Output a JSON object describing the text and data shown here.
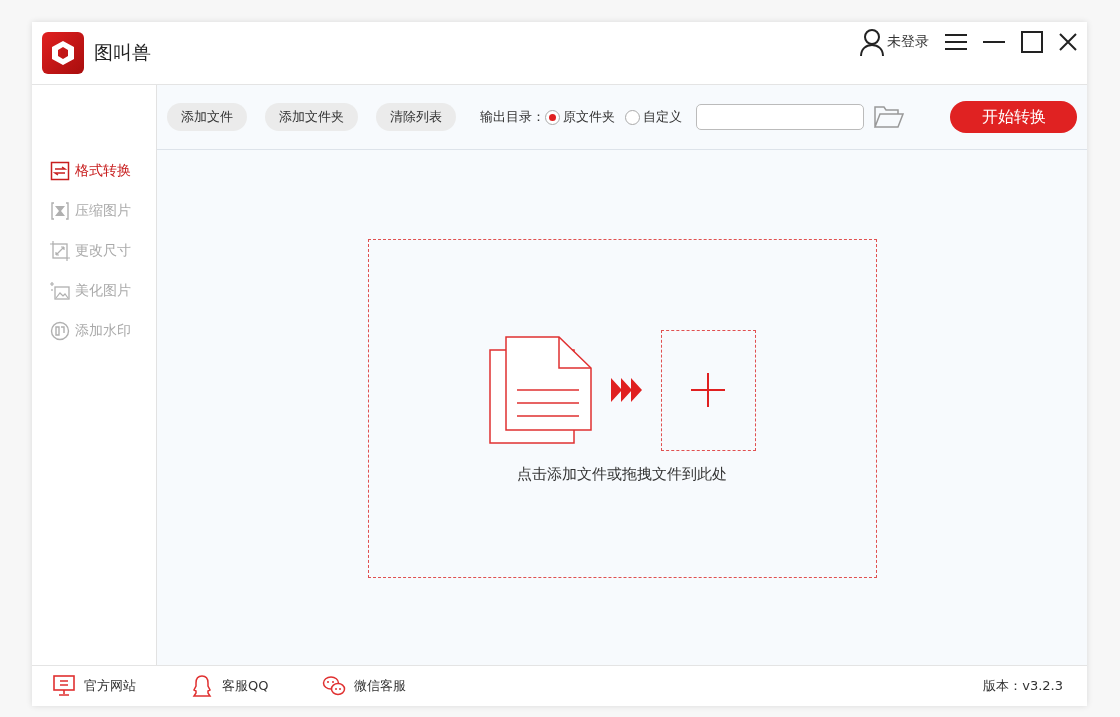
{
  "app": {
    "name": "图叫兽"
  },
  "user": {
    "label": "未登录"
  },
  "sidebar": {
    "items": [
      {
        "label": "格式转换",
        "selected": true
      },
      {
        "label": "压缩图片",
        "selected": false
      },
      {
        "label": "更改尺寸",
        "selected": false
      },
      {
        "label": "美化图片",
        "selected": false
      },
      {
        "label": "添加水印",
        "selected": false
      }
    ]
  },
  "toolbar": {
    "buttons": [
      "添加文件",
      "添加文件夹",
      "清除列表"
    ],
    "output_label": "输出目录：",
    "output_options": [
      {
        "label": "原文件夹",
        "selected": true
      },
      {
        "label": "自定义",
        "selected": false
      }
    ],
    "start_button": "开始转换"
  },
  "dropzone": {
    "hint": "点击添加文件或拖拽文件到此处"
  },
  "footer": {
    "links": [
      "官方网站",
      "客服QQ",
      "微信客服"
    ],
    "version": "版本：v3.2.3"
  }
}
